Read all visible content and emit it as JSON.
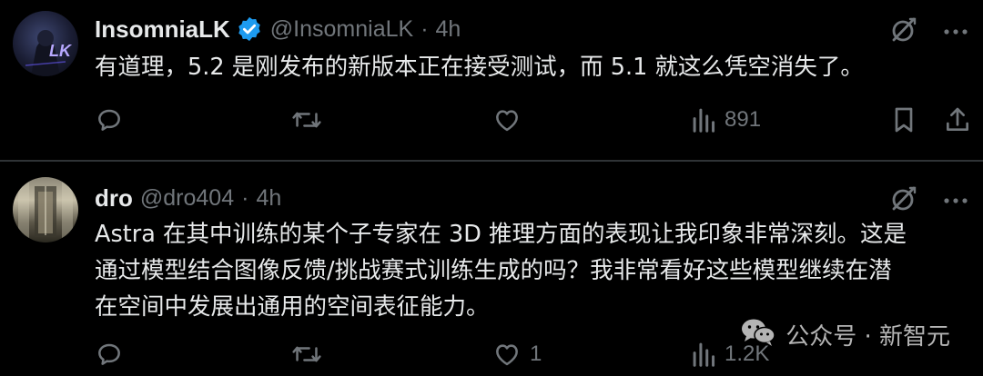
{
  "tweets": [
    {
      "name": "InsomniaLK",
      "verified": true,
      "handle": "@InsomniaLK",
      "separator": "·",
      "time": "4h",
      "text": "有道理，5.2 是刚发布的新版本正在接受测试，而 5.1 就这么凭空消失了。",
      "avatar_text": "LK",
      "stats": {
        "replies": "",
        "reposts": "",
        "likes": "",
        "views": "891"
      }
    },
    {
      "name": "dro",
      "verified": false,
      "handle": "@dro404",
      "separator": "·",
      "time": "4h",
      "text_lines": [
        "Astra 在其中训练的某个子专家在 3D 推理方面的表现让我印象非常深刻。这是",
        "通过模型结合图像反馈/挑战赛式训练生成的吗？我非常看好这些模型继续在潜",
        "在空间中发展出通用的空间表征能力。"
      ],
      "stats": {
        "replies": "",
        "reposts": "",
        "likes": "1",
        "views": "1.2K"
      }
    }
  ],
  "watermark": {
    "text": "公众号 · 新智元"
  },
  "colors": {
    "background": "#000000",
    "text": "#e7e9ea",
    "muted": "#71767b",
    "verified": "#1d9bf0",
    "divider": "#2f3336"
  },
  "icons": {
    "reply": "reply-icon",
    "repost": "repost-icon",
    "like": "like-icon",
    "views": "views-icon",
    "bookmark": "bookmark-icon",
    "share": "share-icon",
    "grok": "grok-icon",
    "more": "more-icon",
    "verified": "verified-badge-icon"
  }
}
